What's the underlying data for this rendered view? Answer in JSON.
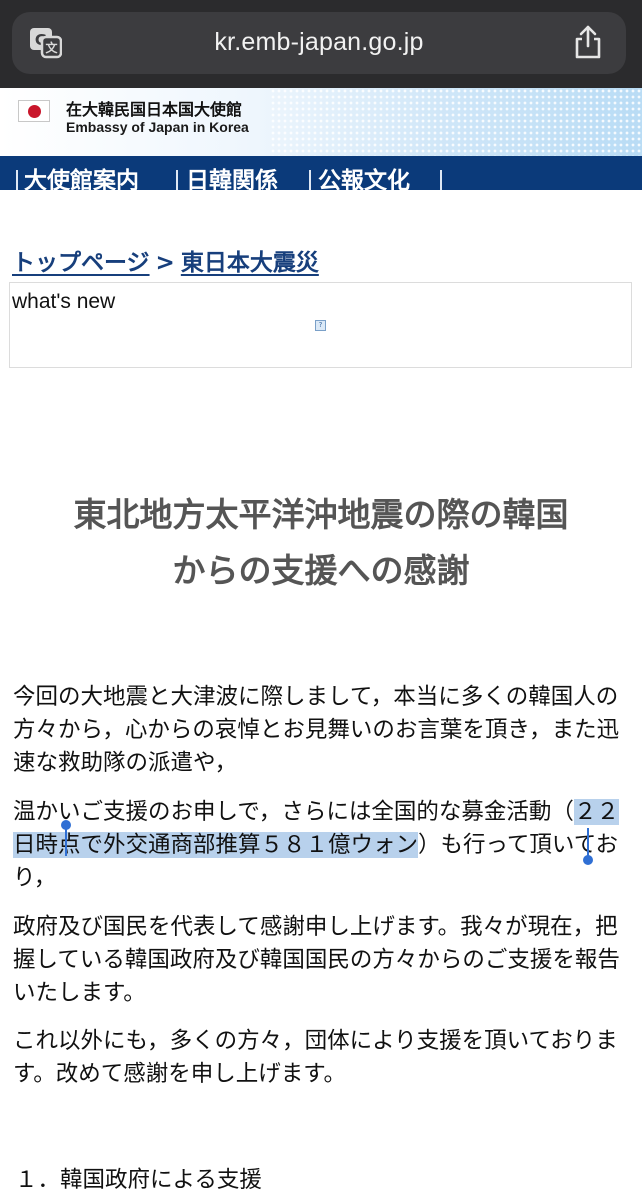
{
  "browser": {
    "url": "kr.emb-japan.go.jp",
    "translate_icon": "translate-icon",
    "share_icon": "share-icon"
  },
  "header": {
    "title_jp": "在大韓民国日本国大使館",
    "title_en": "Embassy of Japan in Korea"
  },
  "nav": {
    "items": [
      "大使館案内",
      "日韓関係",
      "公報文化"
    ]
  },
  "breadcrumb": {
    "home": "トップページ",
    "separator": ">",
    "current": "東日本大震災"
  },
  "whatsnew": {
    "label": "what's new",
    "broken_image_glyph": "?"
  },
  "article": {
    "title_line1": "東北地方太平洋沖地震の際の韓国",
    "title_line2": "からの支援への感謝",
    "p1": "今回の大地震と大津波に際しまして，本当に多くの韓国人の方々から，心からの哀悼とお見舞いのお言葉を頂き，また迅速な救助隊の派遣や，",
    "p2_before": "温かいご支援のお申しで，さらには全国的な募金活動（",
    "p2_selected": "２２日時点で外交通商部推算５８１億ウォン",
    "p2_after": "）も行って頂いており，",
    "p3": "政府及び国民を代表して感謝申し上げます。我々が現在，把握している韓国政府及び韓国国民の方々からのご支援を報告いたします。",
    "p4": "これ以外にも，多くの方々，団体により支援を頂いております。改めて感謝を申し上げます。",
    "section1": "１．韓国政府による支援"
  },
  "colors": {
    "chrome": "#2b2b2d",
    "navbar": "#0b3a7a",
    "link": "#173f7c",
    "selection": "#b8d1ec",
    "handle": "#2f6fd4"
  }
}
